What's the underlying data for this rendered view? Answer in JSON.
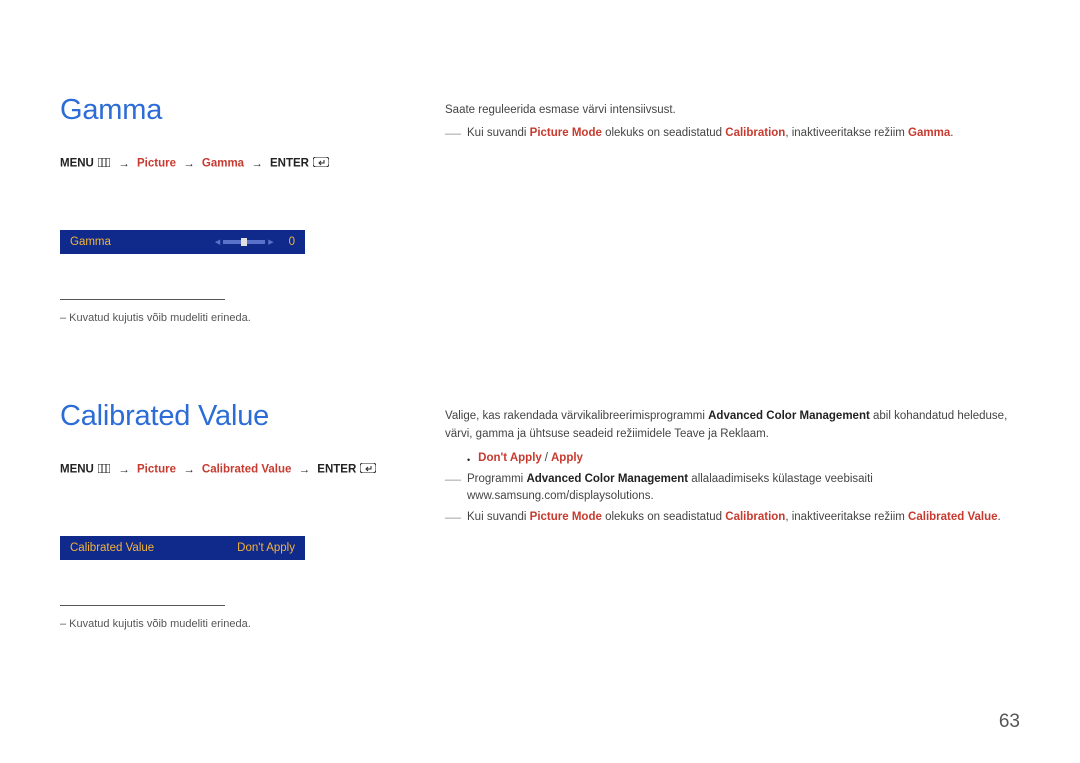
{
  "gamma": {
    "heading": "Gamma",
    "breadcrumb": {
      "menu": "MENU",
      "picture": "Picture",
      "gamma": "Gamma",
      "enter": "ENTER"
    },
    "ui": {
      "label": "Gamma",
      "value": "0"
    },
    "footnote": "– Kuvatud kujutis võib mudeliti erineda.",
    "desc": "Saate reguleerida esmase värvi intensiivsust.",
    "note": {
      "pre": "Kui suvandi ",
      "picture_mode": "Picture Mode",
      "mid": " olekuks on seadistatud ",
      "calibration": "Calibration",
      "post": ", inaktiveeritakse režiim ",
      "gamma": "Gamma",
      "end": "."
    }
  },
  "calibrated": {
    "heading": "Calibrated Value",
    "breadcrumb": {
      "menu": "MENU",
      "picture": "Picture",
      "cal": "Calibrated Value",
      "enter": "ENTER"
    },
    "ui": {
      "label": "Calibrated Value",
      "value": "Don't Apply"
    },
    "footnote": "– Kuvatud kujutis võib mudeliti erineda.",
    "desc": {
      "pre": "Valige, kas rakendada värvikalibreerimisprogrammi ",
      "acm": "Advanced Color Management",
      "post": " abil kohandatud heleduse, värvi, gamma ja ühtsuse seadeid režiimidele Teave ja Reklaam."
    },
    "options": {
      "dont_apply": "Don't Apply",
      "apply": "Apply"
    },
    "note1": {
      "pre": "Programmi ",
      "acm": "Advanced Color Management",
      "post": " allalaadimiseks külastage veebisaiti www.samsung.com/displaysolutions."
    },
    "note2": {
      "pre": "Kui suvandi ",
      "picture_mode": "Picture Mode",
      "mid": " olekuks on seadistatud ",
      "calibration": "Calibration",
      "post": ", inaktiveeritakse režiim ",
      "cal": "Calibrated Value",
      "end": "."
    }
  },
  "page": "63"
}
